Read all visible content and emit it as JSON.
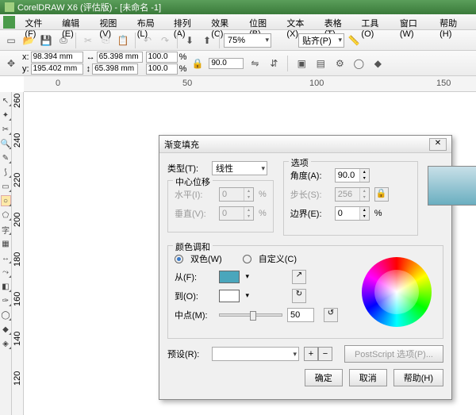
{
  "title": "CorelDRAW X6 (评估版) - [未命名 -1]",
  "menu": [
    "文件(F)",
    "编辑(E)",
    "视图(V)",
    "布局(L)",
    "排列(A)",
    "效果(C)",
    "位图(B)",
    "文本(X)",
    "表格(T)",
    "工具(O)",
    "窗口(W)",
    "帮助(H)"
  ],
  "toolbar": {
    "zoom": "75%",
    "snap": "贴齐(P)"
  },
  "props": {
    "x_label": "x:",
    "x": "98.394 mm",
    "y_label": "y:",
    "y": "195.402 mm",
    "w": "65.398 mm",
    "h": "65.398 mm",
    "sx": "100.0",
    "sy": "100.0",
    "pct": "%",
    "rot": "90.0"
  },
  "ruler_h": [
    "0",
    "50",
    "100",
    "150"
  ],
  "ruler_v": [
    "260",
    "240",
    "220",
    "200",
    "180",
    "160",
    "140",
    "120"
  ],
  "dialog": {
    "title": "渐变填充",
    "type_label": "类型(T):",
    "type_value": "线性",
    "center_group": "中心位移",
    "hx_label": "水平(I):",
    "hx": "0",
    "hy_label": "垂直(V):",
    "hy": "0",
    "pct": "%",
    "options_group": "选项",
    "angle_label": "角度(A):",
    "angle": "90.0",
    "steps_label": "步长(S):",
    "steps": "256",
    "edge_label": "边界(E):",
    "edge": "0",
    "blend_group": "颜色调和",
    "two_color": "双色(W)",
    "custom": "自定义(C)",
    "from_label": "从(F):",
    "to_label": "到(O):",
    "mid_label": "中点(M):",
    "mid": "50",
    "preset_label": "预设(R):",
    "postscript": "PostScript 选项(P)...",
    "ok": "确定",
    "cancel": "取消",
    "help": "帮助(H)",
    "from_color": "#4aa6bc",
    "to_color": "#ffffff"
  }
}
